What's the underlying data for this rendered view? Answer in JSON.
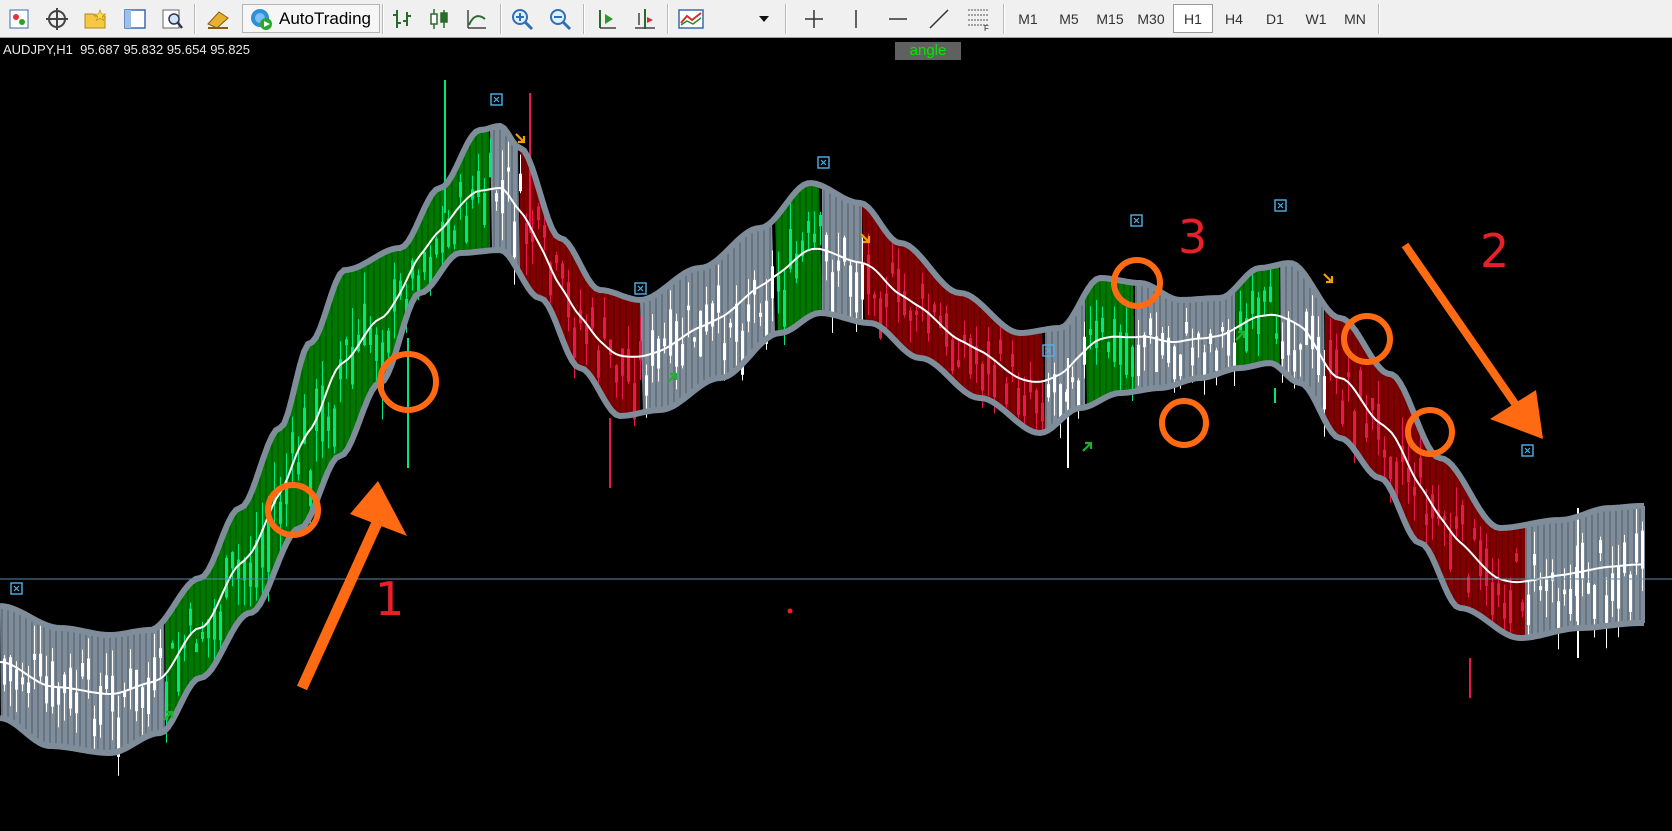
{
  "toolbar": {
    "autotrading_label": "AutoTrading",
    "timeframes": [
      "M1",
      "M5",
      "M15",
      "M30",
      "H1",
      "H4",
      "D1",
      "W1",
      "MN"
    ],
    "active_timeframe": "H1"
  },
  "chart": {
    "symbol_info": "AUDJPY,H1  95.687 95.832 95.654 95.825",
    "indicator_label": "angle",
    "annotations": [
      "1",
      "2",
      "3"
    ],
    "colors": {
      "background": "#000000",
      "band_outline": "#7f8d9b",
      "uptrend_fill": "#007800",
      "downtrend_fill": "#800000",
      "neutral_fill": "#7f8d9b",
      "bull_candle": "#00e87a",
      "bear_candle": "#e8194a",
      "neutral_candle": "#ffffff",
      "annotation_marker": "#ff6a13",
      "annotation_text": "#e8202a"
    }
  }
}
